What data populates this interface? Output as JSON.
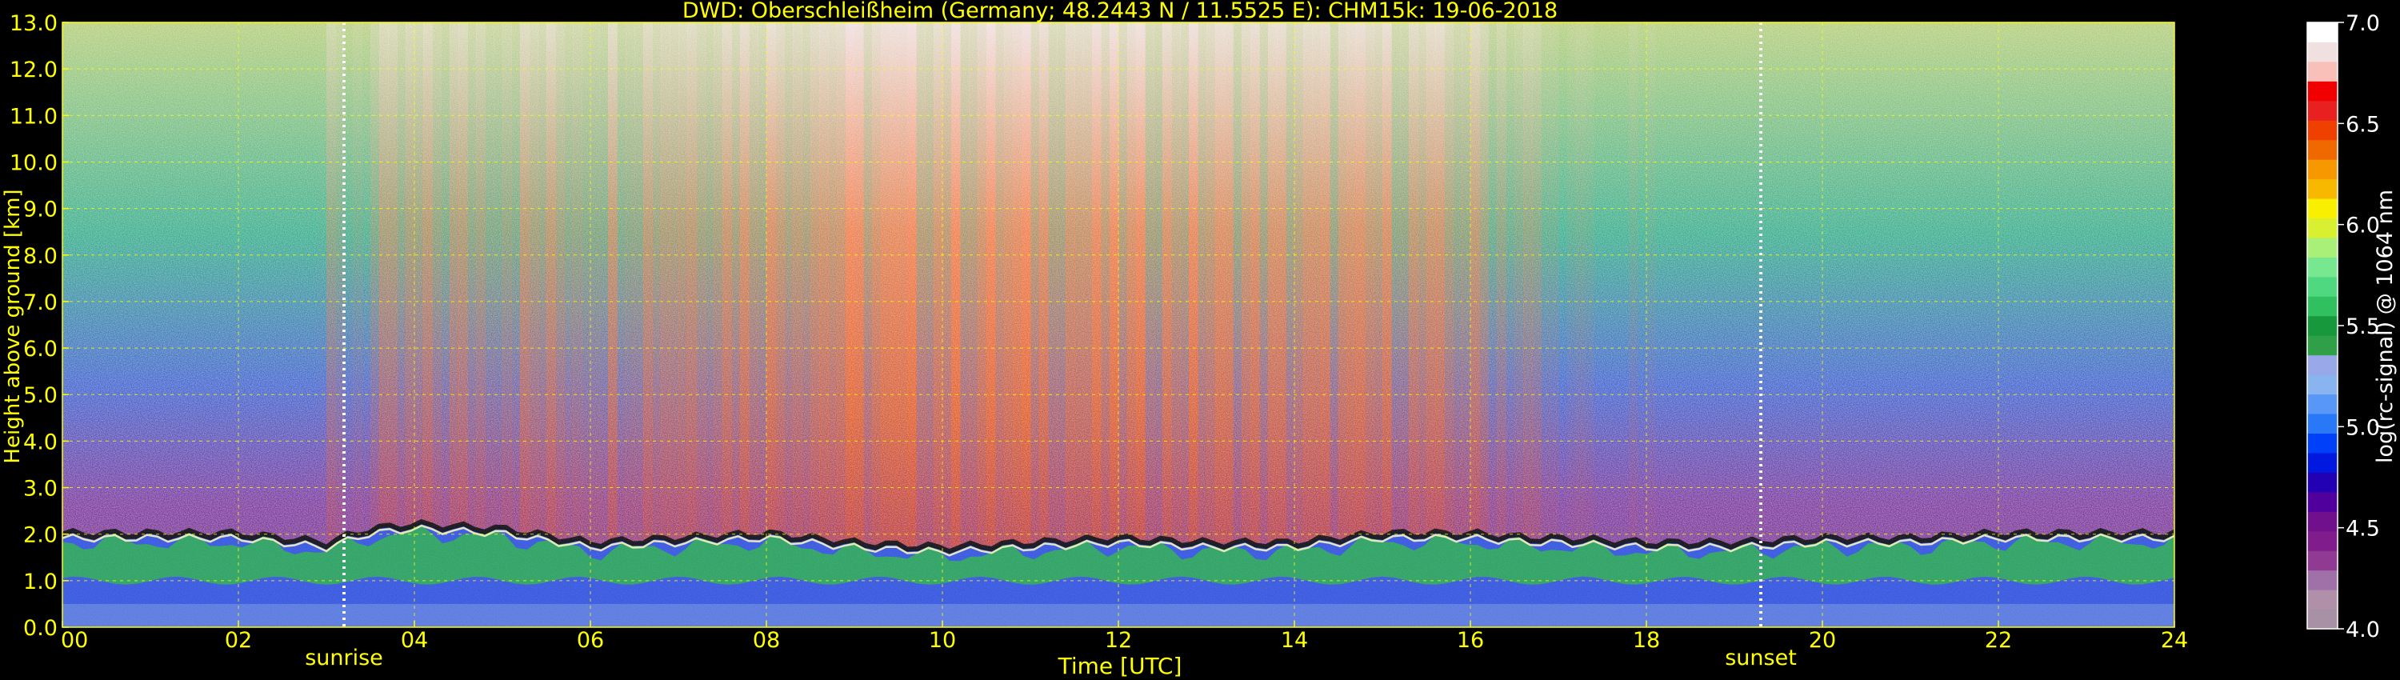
{
  "chart_data": {
    "type": "heatmap",
    "title": "DWD: Oberschleißheim (Germany; 48.2443 N / 11.5525 E):    CHM15k: 19-06-2018",
    "xlabel": "Time [UTC]",
    "ylabel": "Height above ground [km]",
    "xlim": [
      0,
      24
    ],
    "ylim": [
      0,
      13
    ],
    "x_ticks": [
      "00",
      "02",
      "04",
      "06",
      "08",
      "10",
      "12",
      "14",
      "16",
      "18",
      "20",
      "22",
      "24"
    ],
    "y_ticks": [
      "0.0",
      "1.0",
      "2.0",
      "3.0",
      "4.0",
      "5.0",
      "6.0",
      "7.0",
      "8.0",
      "9.0",
      "10.0",
      "11.0",
      "12.0",
      "13.0"
    ],
    "grid": true,
    "markers": [
      {
        "label": "sunrise",
        "x": 3.2
      },
      {
        "label": "sunset",
        "x": 19.3
      }
    ],
    "colorbar": {
      "label": "log(rc-signal) @ 1064 nm",
      "range": [
        4.0,
        7.0
      ],
      "ticks": [
        "4.0",
        "4.5",
        "5.0",
        "5.5",
        "6.0",
        "6.5",
        "7.0"
      ],
      "colors": [
        "#a891a4",
        "#b090a8",
        "#a070a8",
        "#903a94",
        "#801c8c",
        "#70108c",
        "#50009c",
        "#2200b4",
        "#0018e0",
        "#0040f8",
        "#2878f8",
        "#5896f8",
        "#88b4f0",
        "#98a8e8",
        "#30a048",
        "#18983c",
        "#30c060",
        "#50d880",
        "#78e890",
        "#a8f078",
        "#d8f030",
        "#f8f000",
        "#f8b800",
        "#f89800",
        "#f06800",
        "#f04000",
        "#e82020",
        "#f00000",
        "#f8c0b8",
        "#f0e0e0",
        "#ffffff"
      ]
    },
    "time_profiles": {
      "x": [
        0,
        1,
        2,
        2.5,
        3,
        3.5,
        4,
        5,
        6,
        7,
        8,
        9,
        10,
        11,
        12,
        13,
        14,
        15,
        16,
        16.7,
        17,
        18,
        19,
        20,
        21,
        22,
        23,
        24
      ],
      "mixing_layer_top_km": [
        2.0,
        2.0,
        2.0,
        1.9,
        1.8,
        2.1,
        2.2,
        2.1,
        1.8,
        1.9,
        2.0,
        1.8,
        1.7,
        1.8,
        1.9,
        1.8,
        1.8,
        2.0,
        2.0,
        1.9,
        1.9,
        1.8,
        1.8,
        1.9,
        1.9,
        2.0,
        2.0,
        2.0
      ],
      "sky_background_level": [
        0.25,
        0.25,
        0.3,
        0.4,
        0.5,
        0.6,
        0.7,
        0.75,
        0.75,
        0.85,
        0.9,
        0.95,
        0.95,
        0.95,
        0.9,
        0.9,
        0.85,
        0.85,
        0.75,
        0.6,
        0.45,
        0.35,
        0.3,
        0.25,
        0.22,
        0.2,
        0.2,
        0.2
      ]
    }
  }
}
